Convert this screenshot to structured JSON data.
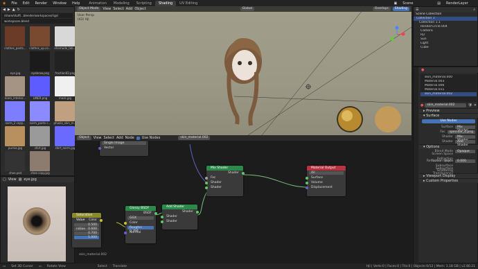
{
  "menu": [
    "File",
    "Edit",
    "Render",
    "Window",
    "Help"
  ],
  "workspaces": [
    "Animation",
    "Modeling",
    "Scripting",
    "Shading",
    "UV Editing"
  ],
  "active_workspace": "Shading",
  "scene_name": "Scene",
  "render_layer": "RenderLayer",
  "filebrowser": {
    "path": "/share/stuff/...blender/workspaces/rigs/",
    "file": "workspaces.blend",
    "items": [
      "clothes_pants...",
      "clothes_up.co...",
      "ehemode_tab...",
      "eye.jpg",
      "eyebrow.png",
      "fraction02.png",
      "kiara_interior...",
      "LINER.png",
      "mask.jpg",
      "norm_2 copy...",
      "norm_pants c...",
      "phazia_skin_m...",
      "purnia.jpg",
      "shirt.jpg",
      "shirt_norm.jpg",
      "shoe.psd",
      "shoe copy.jpg"
    ]
  },
  "viewport": {
    "mode": "Object Mode",
    "menu": [
      "View",
      "Select",
      "Add",
      "Object"
    ],
    "info1": "User Persp",
    "info2": "(43) Hjl",
    "transform": "Global",
    "overlays": "Overlays",
    "shading": "Shading"
  },
  "node_editor": {
    "mode": "Object",
    "menu": [
      "View",
      "Select",
      "Add",
      "Node"
    ],
    "use_nodes": "Use Nodes",
    "material": "skin_material.002",
    "footer": "skin_material.002"
  },
  "nodes": {
    "image_texture": {
      "field": "Single Image",
      "out": "Vector"
    },
    "mix_shader": {
      "title": "Mix Shader",
      "out": "Shader",
      "in": [
        "Fac",
        "Shader",
        "Shader"
      ]
    },
    "material_output": {
      "title": "Material Output",
      "target": "All",
      "in": [
        "Surface",
        "Volume",
        "Displacement"
      ]
    },
    "glossy": {
      "title": "Glossy BSDF",
      "out": "BSDF",
      "dist": "GGX",
      "in": [
        "Color",
        "Roughn: 0.394",
        "Normal"
      ]
    },
    "add_shader": {
      "title": "Add Shader",
      "out": "Shader",
      "in": [
        "Shader",
        "Shader"
      ]
    },
    "saturation": {
      "title": "Saturation Value",
      "out": "Color",
      "rows": [
        "0.500",
        "0.600",
        "0.700",
        "1.000"
      ],
      "labels": [
        "",
        "ration",
        "",
        ""
      ]
    }
  },
  "image_editor": {
    "menu": "View",
    "image": "eye.jpg"
  },
  "outliner": {
    "title": "Scene Collection",
    "items": [
      "Collection 1",
      "Collection 1.1",
      "RenderCircle.004",
      "Camera",
      "Hjl",
      "Sun",
      "Light",
      "Cube"
    ]
  },
  "materials": {
    "slots": [
      "skin_material.000",
      "Material.003",
      "Material.006",
      "Material.011",
      "skin_material.002"
    ],
    "active_material": "skin_material.002"
  },
  "properties": {
    "preview": "Preview",
    "surface": "Surface",
    "use_nodes": "Use Nodes",
    "rows": [
      {
        "label": "Surface",
        "value": "Mix Shader"
      },
      {
        "label": "Fac",
        "value": "specular_4.png"
      },
      {
        "label": "Shader",
        "value": "Mix Shader"
      },
      {
        "label": "Shader",
        "value": "Add Shader"
      }
    ],
    "options": "Options",
    "opt_rows": [
      {
        "label": "Blend Mode",
        "value": "Opaque"
      },
      {
        "label": "Screen Space Refraction",
        "value": ""
      },
      {
        "label": "Refraction Depth",
        "value": "0.000"
      },
      {
        "label": "Screen Space Subsurface Scattering",
        "value": ""
      },
      {
        "label": "Subsurface Translucency",
        "value": ""
      }
    ],
    "viewport_display": "Viewport Display",
    "custom_props": "Custom Properties"
  },
  "status": {
    "left": [
      "Set 3D Cursor",
      "Rotate View",
      "Select",
      "Translate"
    ],
    "right": "Hjl | Verts:0 | Faces:0 | Tris:0 | Objects:0/12 | Mem: 1.18 GB | v2.80.21"
  },
  "colors": {
    "accent": "#4772b3",
    "shader_node": "#2b8a4a",
    "output_node": "#b83240",
    "input_node": "#8a8a2a"
  }
}
